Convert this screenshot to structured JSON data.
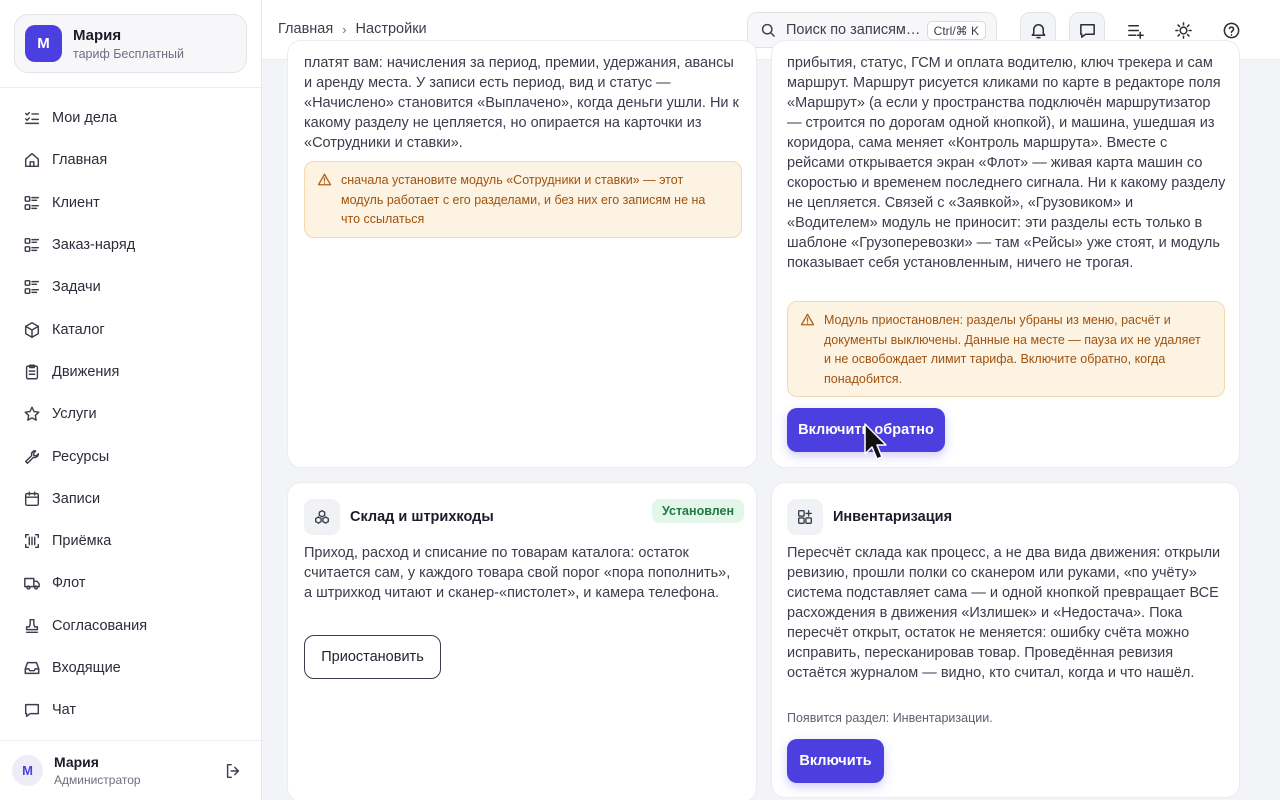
{
  "account": {
    "initial": "М",
    "name": "Мария",
    "plan": "тариф Бесплатный"
  },
  "nav": [
    {
      "label": "Мои дела",
      "icon": "checklist-icon"
    },
    {
      "label": "Главная",
      "icon": "home-icon"
    },
    {
      "label": "Клиент",
      "icon": "list-icon"
    },
    {
      "label": "Заказ-наряд",
      "icon": "list-icon"
    },
    {
      "label": "Задачи",
      "icon": "list-icon"
    },
    {
      "label": "Каталог",
      "icon": "box-icon"
    },
    {
      "label": "Движения",
      "icon": "clipboard-icon"
    },
    {
      "label": "Услуги",
      "icon": "star-icon"
    },
    {
      "label": "Ресурсы",
      "icon": "wrench-icon"
    },
    {
      "label": "Записи",
      "icon": "calendar-icon"
    },
    {
      "label": "Приёмка",
      "icon": "barcode-scan-icon"
    },
    {
      "label": "Флот",
      "icon": "truck-icon"
    },
    {
      "label": "Согласования",
      "icon": "stamp-icon"
    },
    {
      "label": "Входящие",
      "icon": "inbox-icon"
    },
    {
      "label": "Чат",
      "icon": "chat-icon"
    }
  ],
  "user": {
    "initial": "М",
    "name": "Мария",
    "role": "Администратор"
  },
  "breadcrumb": {
    "home": "Главная",
    "current": "Настройки"
  },
  "search": {
    "placeholder": "Поиск по записям…",
    "shortcut": "Ctrl/⌘ K"
  },
  "cards": {
    "payroll": {
      "text": "платят вам: начисления за период, премии, удержания, авансы и аренду места. У записи есть период, вид и статус — «Начислено» становится «Выплачено», когда деньги ушли. Ни к какому разделу не цепляется, но опирается на карточки из «Сотрудники и ставки».",
      "warning": "сначала установите модуль «Сотрудники и ставки» — этот модуль работает с его разделами, и без них его записям не на что ссылаться"
    },
    "trips": {
      "text": "прибытия, статус, ГСМ и оплата водителю, ключ трекера и сам маршрут. Маршрут рисуется кликами по карте в редакторе поля «Маршрут» (а если у пространства подключён маршрутизатор — строится по дорогам одной кнопкой), и машина, ушедшая из коридора, сама меняет «Контроль маршрута». Вместе с рейсами открывается экран «Флот» — живая карта машин со скоростью и временем последнего сигнала. Ни к какому разделу не цепляется. Связей с «Заявкой», «Грузовиком» и «Водителем» модуль не приносит: эти разделы есть только в шаблоне «Грузоперевозки» — там «Рейсы» уже стоят, и модуль показывает себя установленным, ничего не трогая.",
      "warning": "Модуль приостановлен: разделы убраны из меню, расчёт и документы выключены. Данные на месте — пауза их не удаляет и не освобождает лимит тарифа. Включите обратно, когда понадобится.",
      "button": "Включить обратно"
    },
    "warehouse": {
      "title": "Склад и штрихкоды",
      "badge": "Установлен",
      "text": "Приход, расход и списание по товарам каталога: остаток считается сам, у каждого товара свой порог «пора пополнить», а штрихкод читают и сканер-«пистолет», и камера телефона.",
      "button": "Приостановить"
    },
    "inventory": {
      "title": "Инвентаризация",
      "text": "Пересчёт склада как процесс, а не два вида движения: открыли ревизию, прошли полки со сканером или руками, «по учёту» система подставляет сама — и одной кнопкой превращает ВСЕ расхождения в движения «Излишек» и «Недостача». Пока пересчёт открыт, остаток не меняется: ошибку счёта можно исправить, пересканировав товар. Проведённая ревизия остаётся журналом — видно, кто считал, когда и что нашёл.",
      "note": "Появится раздел: Инвентаризации.",
      "button": "Включить"
    }
  },
  "colors": {
    "accent": "#4b3fe0",
    "warning_bg": "#fdf3e2",
    "warning_text": "#a0520f",
    "success_bg": "#e4f5ea",
    "success_text": "#1f7a40"
  }
}
